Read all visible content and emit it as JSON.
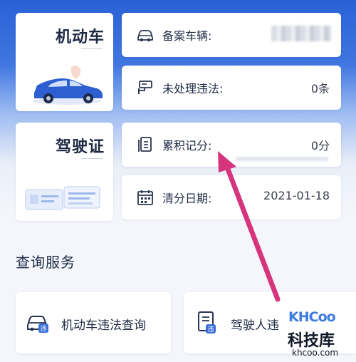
{
  "tiles": {
    "vehicle": {
      "title": "机动车",
      "icon": "car-illustration-icon"
    },
    "license": {
      "title": "驾驶证",
      "icon": "license-card-illustration-icon"
    }
  },
  "rows": {
    "registered_vehicles": {
      "label": "备案车辆:",
      "value": "",
      "icon": "car-outline-icon"
    },
    "unprocessed_violations": {
      "label": "未处理违法:",
      "value": "0条",
      "icon": "camera-icon"
    },
    "accumulated_points": {
      "label": "累积记分:",
      "value": "0分",
      "icon": "document-icon"
    },
    "clear_date": {
      "label": "清分日期:",
      "value": "2021-01-18",
      "icon": "calendar-icon"
    }
  },
  "section": {
    "title": "查询服务"
  },
  "services": [
    {
      "label": "机动车违法查询",
      "icon": "car-violation-icon"
    },
    {
      "label": "驾驶人违",
      "icon": "driver-document-icon"
    }
  ],
  "watermark": {
    "logo": "KHCoo",
    "name": "科技库",
    "url": "khcoo.com"
  },
  "colors": {
    "accent": "#d6357e",
    "blue": "#3a6fd8",
    "text": "#1e2a44"
  }
}
